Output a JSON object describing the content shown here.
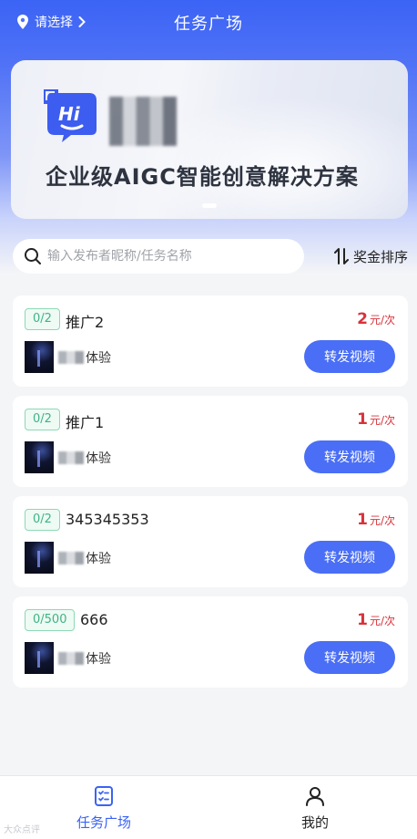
{
  "header": {
    "location_label": "请选择",
    "title": "任务广场"
  },
  "banner": {
    "logo_text": "Hi",
    "slogan": "企业级AIGC智能创意解决方案"
  },
  "search": {
    "placeholder": "输入发布者昵称/任务名称",
    "sort_label": "奖金排序"
  },
  "tasks": [
    {
      "quota": "0/2",
      "name": "推广2",
      "price": "2",
      "unit": "元/次",
      "publisher_suffix": "体验",
      "action": "转发视频"
    },
    {
      "quota": "0/2",
      "name": "推广1",
      "price": "1",
      "unit": "元/次",
      "publisher_suffix": "体验",
      "action": "转发视频"
    },
    {
      "quota": "0/2",
      "name": "345345353",
      "price": "1",
      "unit": "元/次",
      "publisher_suffix": "体验",
      "action": "转发视频"
    },
    {
      "quota": "0/500",
      "name": "666",
      "price": "1",
      "unit": "元/次",
      "publisher_suffix": "体验",
      "action": "转发视频"
    }
  ],
  "tabbar": {
    "items": [
      {
        "label": "任务广场",
        "icon": "task-list-icon",
        "active": true
      },
      {
        "label": "我的",
        "icon": "user-icon",
        "active": false
      }
    ]
  },
  "watermark": "大众点评",
  "colors": {
    "primary": "#4a6ef5",
    "price": "#d8323b",
    "tag_green": "#3fb386"
  }
}
